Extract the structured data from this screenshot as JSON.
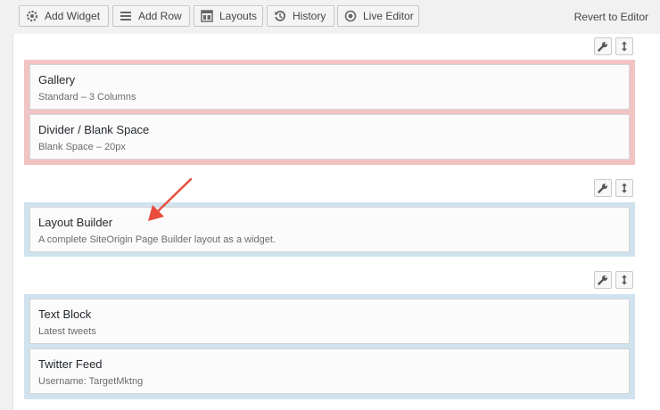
{
  "toolbar": {
    "buttons": [
      {
        "label": "Add Widget",
        "icon": "gear-icon"
      },
      {
        "label": "Add Row",
        "icon": "rows-icon"
      },
      {
        "label": "Layouts",
        "icon": "layout-icon"
      },
      {
        "label": "History",
        "icon": "history-icon"
      },
      {
        "label": "Live Editor",
        "icon": "eye-icon"
      }
    ],
    "revert_label": "Revert to Editor"
  },
  "rows": [
    {
      "widgets": [
        {
          "title": "Gallery",
          "description": "Standard – 3 Columns"
        },
        {
          "title": "Divider / Blank Space",
          "description": "Blank Space – 20px"
        }
      ]
    },
    {
      "widgets": [
        {
          "title": "Layout Builder",
          "description": "A complete SiteOrigin Page Builder layout as a widget."
        }
      ]
    },
    {
      "widgets": [
        {
          "title": "Text Block",
          "description": "Latest tweets"
        },
        {
          "title": "Twitter Feed",
          "description": "Username: TargetMktng"
        }
      ]
    }
  ],
  "colors": {
    "row_highlight": "#f1c3c3",
    "row_default": "#cfe2ee",
    "annotation_arrow": "#e74c3c"
  }
}
